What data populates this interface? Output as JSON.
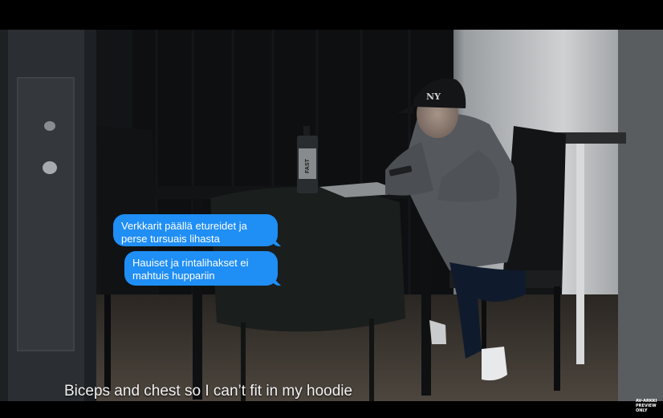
{
  "video": {
    "message_bubbles": [
      {
        "text": "Verkkarit päällä etureidet ja\nperse tursuais lihasta"
      },
      {
        "text": "Hauiset ja rintalihakset ei\nmahtuis huppariin"
      }
    ],
    "subtitle": "Biceps and chest so I can’t fit in my hoodie",
    "watermark": "AV-ARKKI PREVIEW ONLY",
    "cap_logo_text": "NY",
    "bottle_label": "FAST"
  },
  "colors": {
    "bubble_blue": "#1f8ef5",
    "letterbox": "#000000",
    "hoodie": "#5a5d61",
    "room_shadow": "#0f1113",
    "wall_light": "#d8dadc"
  }
}
